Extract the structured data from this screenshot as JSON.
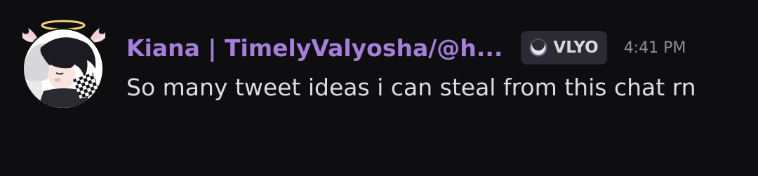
{
  "message": {
    "author": {
      "display_name": "Kiana | TimelyValyosha/@h...",
      "name_color": "#a57fd9",
      "avatar_icon": "anime-avatar-with-halo-and-wings"
    },
    "server_tag": {
      "icon": "crescent-moon-badge-icon",
      "text": "VLYO"
    },
    "timestamp": "4:41 PM",
    "content": "So many tweet ideas i can steal from this chat rn"
  },
  "colors": {
    "background": "#0e0e11",
    "text": "#dcdde1",
    "muted": "#8d8e95",
    "tag_bg": "#2b2b31"
  }
}
